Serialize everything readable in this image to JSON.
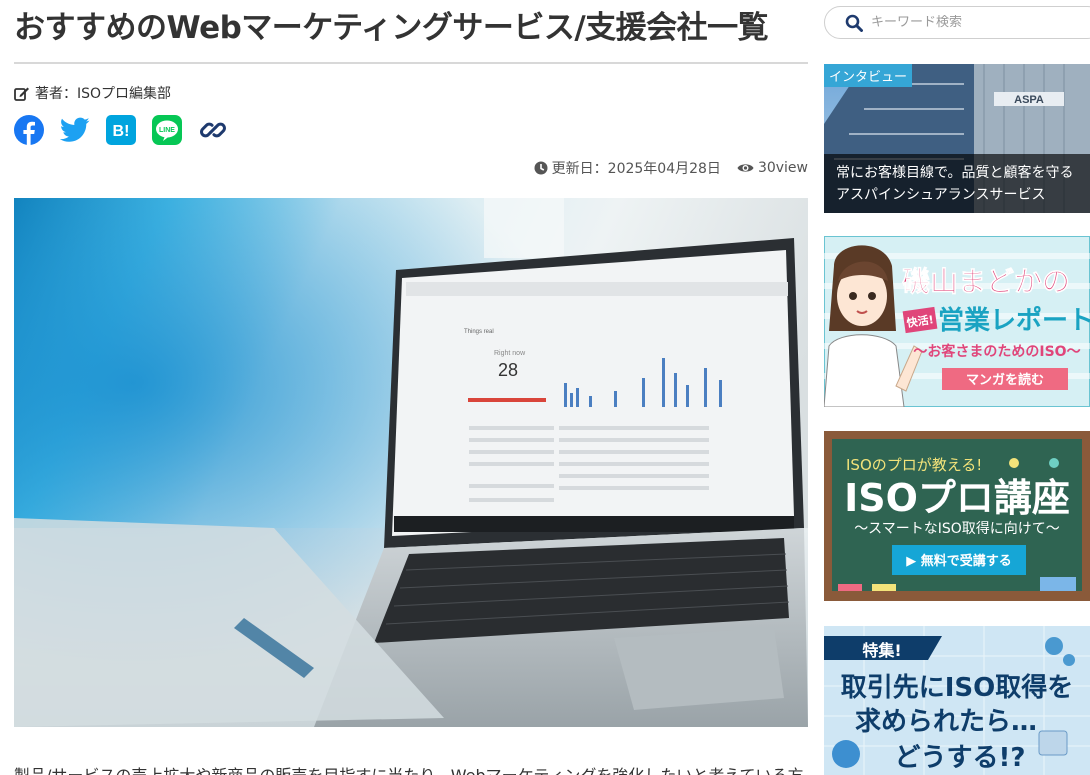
{
  "article": {
    "title": "おすすめのWebマーケティングサービス/支援会社一覧",
    "author_label": "著者：ISOプロ編集部",
    "updated_label": "更新日：2025年04月28日",
    "views": "30view",
    "lead": "製品/サービスの売上拡大や新商品の販売を目指すに当たり、Webマーケティングを強化したいと考えている方"
  },
  "share": {
    "icons": [
      "facebook-icon",
      "twitter-icon",
      "hatena-bookmark-icon",
      "line-icon",
      "link-icon"
    ],
    "hatena_label": "B!",
    "line_label": "LINE"
  },
  "hero": {
    "screen_title": "Things real",
    "right_now_label": "Right now",
    "right_now_value": "28"
  },
  "sidebar": {
    "search_placeholder": "キーワード検索",
    "interview_card": {
      "badge": "インタビュー",
      "building_sign": "ASPA",
      "caption": "常にお客様目線で。品質と顧客を守るアスパインシュアランスサービス"
    },
    "banner_manga": {
      "title_line1": "磯山まどかの",
      "stamp": "快活!",
      "title_line2": "営業レポート",
      "subtitle": "〜お客さまのためのISO〜",
      "button": "マンガを読む"
    },
    "banner_course": {
      "top": "ISOのプロが教える!",
      "title": "ISOプロ講座",
      "subtitle": "〜スマートなISO取得に向けて〜",
      "button": "▶ 無料で受講する"
    },
    "banner_feature": {
      "tag": "特集!",
      "line1": "取引先にISO取得を",
      "line2": "求められたら…",
      "line3": "どうする!?"
    }
  },
  "colors": {
    "facebook": "#1877f2",
    "twitter": "#1da1f2",
    "hatena": "#00a4de",
    "line": "#06c755",
    "link": "#1e3a6e",
    "badge": "#35a6d6"
  }
}
